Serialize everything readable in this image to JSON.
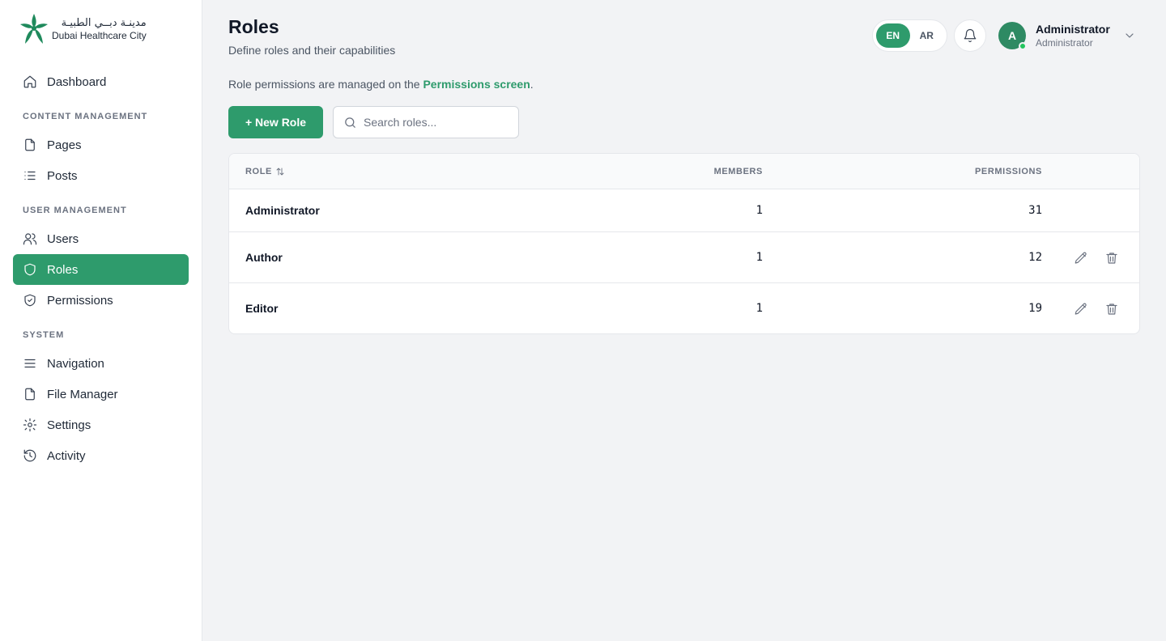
{
  "brand": {
    "name_ar": "مدينـة دبــي الطبيـة",
    "name_en": "Dubai Healthcare City",
    "color": "#2e9b6c"
  },
  "sidebar": {
    "items": [
      {
        "type": "item",
        "label": "Dashboard",
        "icon": "home-icon"
      },
      {
        "type": "section",
        "label": "CONTENT MANAGEMENT"
      },
      {
        "type": "item",
        "label": "Pages",
        "icon": "file-icon"
      },
      {
        "type": "item",
        "label": "Posts",
        "icon": "list-icon"
      },
      {
        "type": "section",
        "label": "USER MANAGEMENT"
      },
      {
        "type": "item",
        "label": "Users",
        "icon": "users-icon"
      },
      {
        "type": "item",
        "label": "Roles",
        "icon": "shield-icon",
        "active": true
      },
      {
        "type": "item",
        "label": "Permissions",
        "icon": "shield-check-icon"
      },
      {
        "type": "section",
        "label": "SYSTEM"
      },
      {
        "type": "item",
        "label": "Navigation",
        "icon": "menu-icon"
      },
      {
        "type": "item",
        "label": "File Manager",
        "icon": "file-icon"
      },
      {
        "type": "item",
        "label": "Settings",
        "icon": "gear-icon"
      },
      {
        "type": "item",
        "label": "Activity",
        "icon": "history-icon"
      }
    ]
  },
  "header": {
    "title": "Roles",
    "subtitle": "Define roles and their capabilities",
    "lang": {
      "en": "EN",
      "ar": "AR",
      "active": "EN"
    },
    "user": {
      "initial": "A",
      "name": "Administrator",
      "role": "Administrator"
    }
  },
  "notice": {
    "prefix": "Role permissions are managed on the ",
    "link": "Permissions screen",
    "suffix": "."
  },
  "toolbar": {
    "new_role_label": "+ New Role",
    "search_placeholder": "Search roles..."
  },
  "table": {
    "columns": {
      "role": "ROLE",
      "members": "MEMBERS",
      "permissions": "PERMISSIONS"
    },
    "rows": [
      {
        "name": "Administrator",
        "members": "1",
        "permissions": "31",
        "editable": false
      },
      {
        "name": "Author",
        "members": "1",
        "permissions": "12",
        "editable": true
      },
      {
        "name": "Editor",
        "members": "1",
        "permissions": "19",
        "editable": true
      }
    ]
  }
}
